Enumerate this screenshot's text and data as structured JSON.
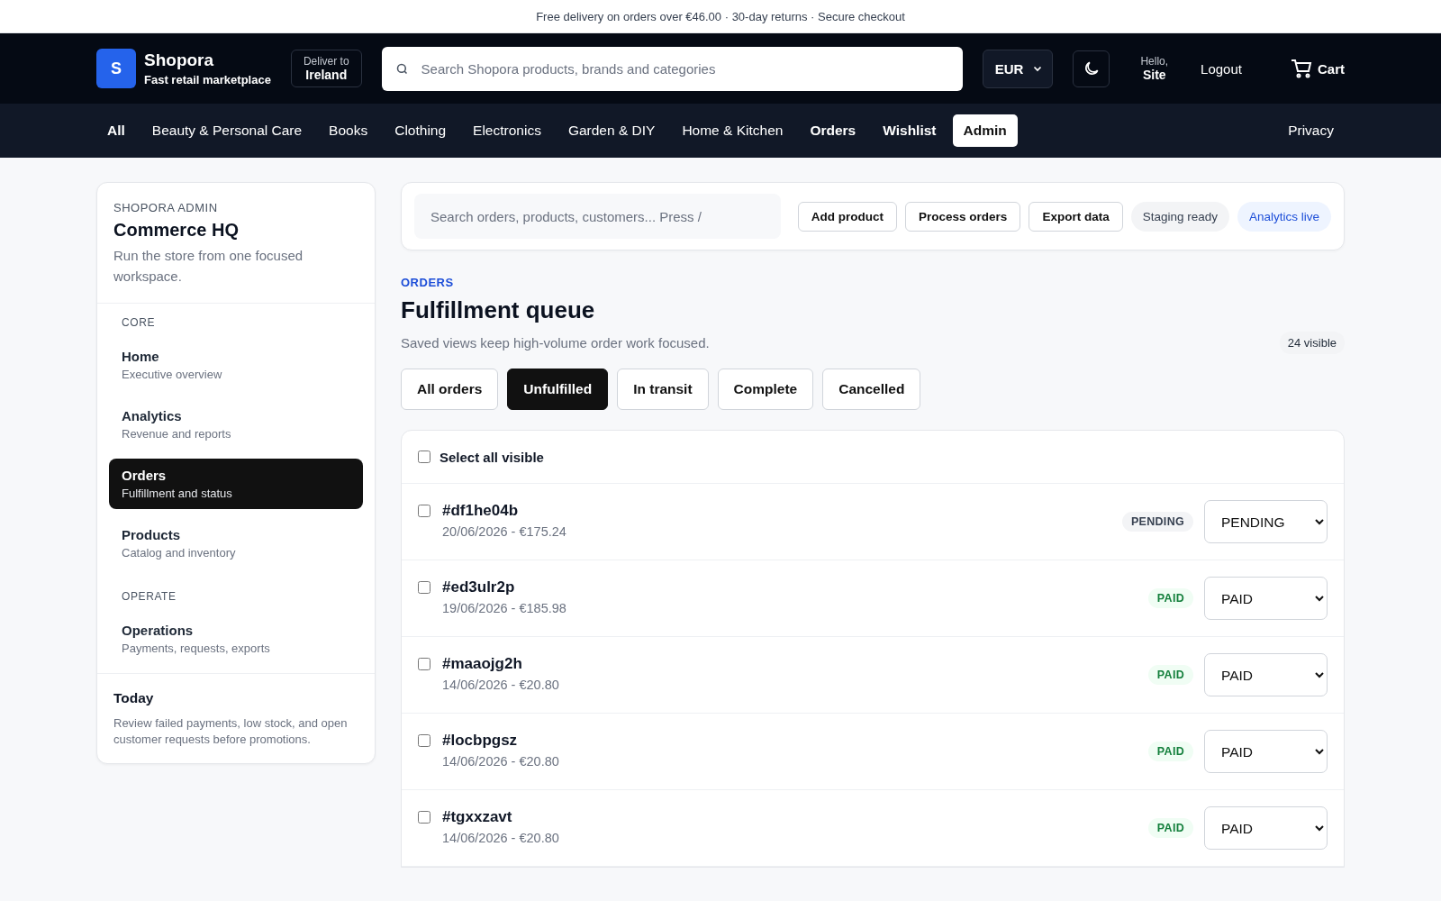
{
  "promo_bar": "Free delivery on orders over €46.00 · 30-day returns · Secure checkout",
  "header": {
    "logo_letter": "S",
    "brand": "Shopora",
    "tagline": "Fast retail marketplace",
    "deliver_label": "Deliver to",
    "deliver_place": "Ireland",
    "search": {
      "placeholder": "Search Shopora products, brands and categories"
    },
    "currency": "EUR",
    "greeting": "Hello,",
    "user": "Site",
    "logout": "Logout",
    "cart": "Cart"
  },
  "nav": {
    "items": [
      {
        "label": "All",
        "selected": false,
        "bold": true
      },
      {
        "label": "Beauty & Personal Care",
        "selected": false,
        "bold": false
      },
      {
        "label": "Books",
        "selected": false,
        "bold": false
      },
      {
        "label": "Clothing",
        "selected": false,
        "bold": false
      },
      {
        "label": "Electronics",
        "selected": false,
        "bold": false
      },
      {
        "label": "Garden & DIY",
        "selected": false,
        "bold": false
      },
      {
        "label": "Home & Kitchen",
        "selected": false,
        "bold": false
      },
      {
        "label": "Orders",
        "selected": false,
        "bold": true
      },
      {
        "label": "Wishlist",
        "selected": false,
        "bold": true
      },
      {
        "label": "Admin",
        "selected": true,
        "bold": true
      }
    ],
    "right": "Privacy"
  },
  "sidebar": {
    "eyebrow": "SHOPORA ADMIN",
    "title": "Commerce HQ",
    "description": "Run the store from one focused workspace.",
    "sections": [
      {
        "heading": "CORE",
        "items": [
          {
            "label": "Home",
            "sub": "Executive overview",
            "selected": false
          },
          {
            "label": "Analytics",
            "sub": "Revenue and reports",
            "selected": false
          },
          {
            "label": "Orders",
            "sub": "Fulfillment and status",
            "selected": true
          },
          {
            "label": "Products",
            "sub": "Catalog and inventory",
            "selected": false
          }
        ]
      },
      {
        "heading": "OPERATE",
        "items": [
          {
            "label": "Operations",
            "sub": "Payments, requests, exports",
            "selected": false
          }
        ]
      }
    ],
    "today": {
      "title": "Today",
      "text": "Review failed payments, low stock, and open customer requests before promotions."
    }
  },
  "toolbar": {
    "search": {
      "placeholder": "Search orders, products, customers... Press /"
    },
    "buttons": [
      "Add product",
      "Process orders",
      "Export data"
    ],
    "chips": [
      {
        "label": "Staging ready",
        "kind": "neutral"
      },
      {
        "label": "Analytics live",
        "kind": "info"
      }
    ]
  },
  "section": {
    "eyebrow": "ORDERS",
    "title": "Fulfillment queue",
    "subtitle": "Saved views keep high-volume order work focused.",
    "count": "24 visible"
  },
  "filters": [
    {
      "label": "All orders",
      "selected": false
    },
    {
      "label": "Unfulfilled",
      "selected": true
    },
    {
      "label": "In transit",
      "selected": false
    },
    {
      "label": "Complete",
      "selected": false
    },
    {
      "label": "Cancelled",
      "selected": false
    }
  ],
  "orders": {
    "select_all": {
      "label": "Select all visible",
      "checked": false
    },
    "rows": [
      {
        "id": "#df1he04b",
        "meta": "20/06/2026 - €175.24",
        "badge": "PENDING",
        "kind": "pending",
        "status": "PENDING",
        "checked": false
      },
      {
        "id": "#ed3ulr2p",
        "meta": "19/06/2026 - €185.98",
        "badge": "PAID",
        "kind": "paid",
        "status": "PAID",
        "checked": false
      },
      {
        "id": "#maaojg2h",
        "meta": "14/06/2026 - €20.80",
        "badge": "PAID",
        "kind": "paid",
        "status": "PAID",
        "checked": false
      },
      {
        "id": "#locbpgsz",
        "meta": "14/06/2026 - €20.80",
        "badge": "PAID",
        "kind": "paid",
        "status": "PAID",
        "checked": false
      },
      {
        "id": "#tgxxzavt",
        "meta": "14/06/2026 - €20.80",
        "badge": "PAID",
        "kind": "paid",
        "status": "PAID",
        "checked": false
      }
    ]
  }
}
